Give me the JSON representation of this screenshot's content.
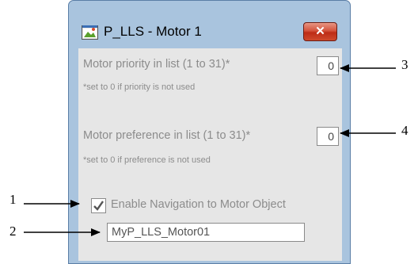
{
  "window": {
    "title": "P_LLS - Motor 1",
    "close_symbol": "✕",
    "icon": "motor-app-icon"
  },
  "form": {
    "priority_label": "Motor priority in list (1 to 31)*",
    "priority_note": "*set to 0 if priority is not used",
    "priority_value": "0",
    "preference_label": "Motor preference in list (1 to 31)*",
    "preference_note": "*set to 0 if preference is not used",
    "preference_value": "0",
    "enable_nav_label": "Enable Navigation to Motor Object",
    "enable_nav_checked": true,
    "motor_object_value": "MyP_LLS_Motor01"
  },
  "callouts": {
    "c1": "1",
    "c2": "2",
    "c3": "3",
    "c4": "4"
  },
  "colors": {
    "frame": "#a9c4de",
    "client_bg": "#e6e6e6",
    "close_button": "#c83a22",
    "disabled_text": "#8c8c8c"
  }
}
